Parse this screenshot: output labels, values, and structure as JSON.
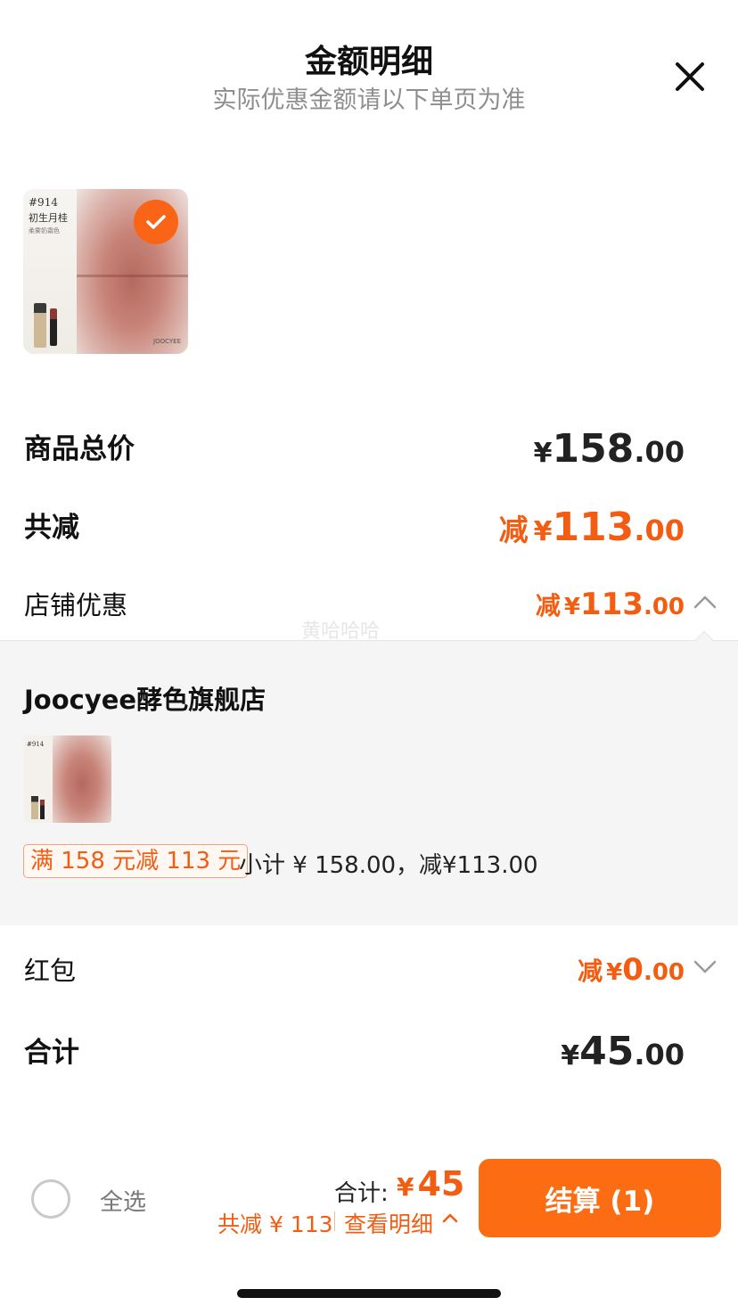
{
  "header": {
    "title": "金额明细",
    "subtitle": "实际优惠金额请以下单页为准"
  },
  "product": {
    "code": "#914",
    "name": "初生月桂",
    "sub": "柔雾奶霜色",
    "brand": "JOOCYEE",
    "selected": true
  },
  "rows": {
    "goods_total": {
      "label": "商品总价",
      "yen": "¥",
      "int": "158",
      "dec": ".00"
    },
    "total_reduce": {
      "label": "共减",
      "prefix": "减",
      "yen": "¥",
      "int": "113",
      "dec": ".00"
    },
    "shop_discount": {
      "label": "店铺优惠",
      "prefix": "减",
      "yen": "¥",
      "int": "113",
      "dec": ".00",
      "expanded": true
    },
    "red_packet": {
      "label": "红包",
      "prefix": "减",
      "yen": "¥",
      "int": "0",
      "dec": ".00",
      "expanded": false
    },
    "grand_total": {
      "label": "合计",
      "yen": "¥",
      "int": "45",
      "dec": ".00"
    }
  },
  "store_panel": {
    "store_name": "Joocyee酵色旗舰店",
    "promo_tag": "满 158 元减 113 元",
    "subtotal": "小计 ¥ 158.00，减¥113.00"
  },
  "watermark": "黄哈哈哈",
  "bottom_bar": {
    "select_all_label": "全选",
    "total_label": "合计:",
    "total_yen": "¥",
    "total_value": "45",
    "reduce_text": "共减 ¥ 113",
    "detail_link": "查看明细",
    "checkout_label": "结算 (1)"
  },
  "colors": {
    "accent": "#f25d12",
    "button": "#fb6c13",
    "panel_bg": "#f5f5f5"
  },
  "icons": [
    "close-icon",
    "check-icon",
    "chevron-up-icon",
    "chevron-down-icon",
    "radio-unchecked-icon"
  ]
}
